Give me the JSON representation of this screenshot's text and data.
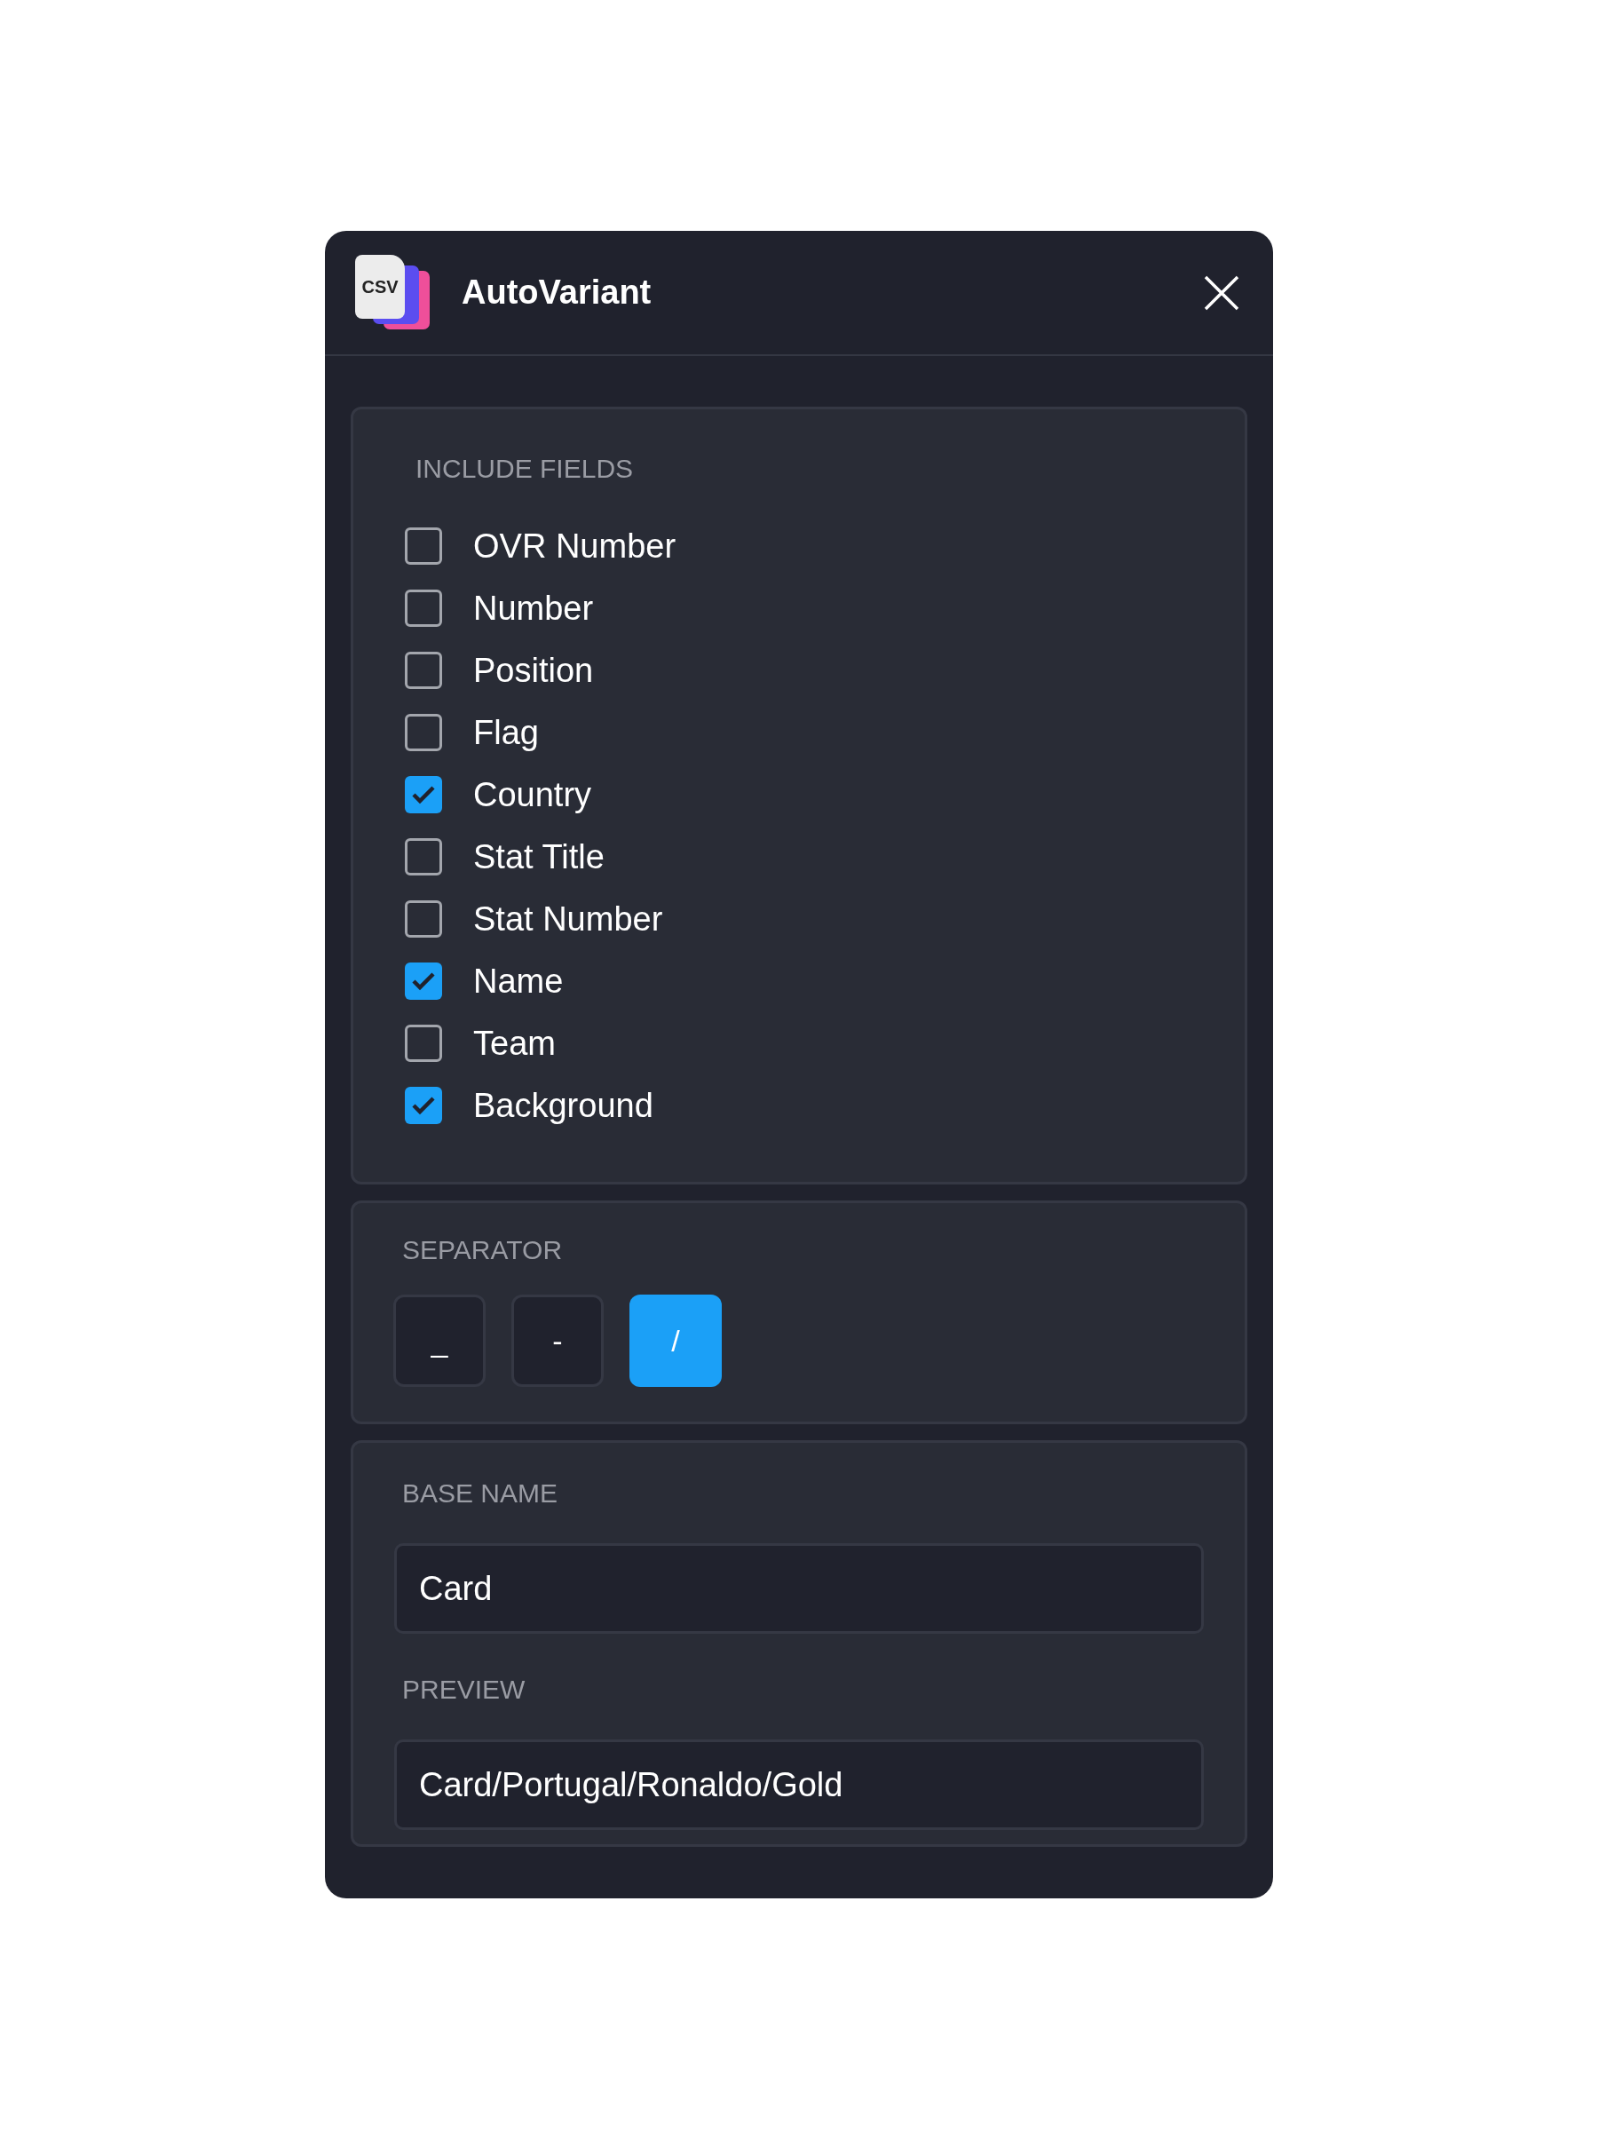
{
  "window": {
    "title": "AutoVariant",
    "logo_text": "CSV"
  },
  "include_fields": {
    "label": "INCLUDE FIELDS",
    "items": [
      {
        "label": "OVR Number",
        "checked": false
      },
      {
        "label": "Number",
        "checked": false
      },
      {
        "label": "Position",
        "checked": false
      },
      {
        "label": "Flag",
        "checked": false
      },
      {
        "label": "Country",
        "checked": true
      },
      {
        "label": "Stat Title",
        "checked": false
      },
      {
        "label": "Stat Number",
        "checked": false
      },
      {
        "label": "Name",
        "checked": true
      },
      {
        "label": "Team",
        "checked": false
      },
      {
        "label": "Background",
        "checked": true
      }
    ]
  },
  "separator": {
    "label": "SEPARATOR",
    "options": [
      {
        "label": "_",
        "selected": false
      },
      {
        "label": "-",
        "selected": false
      },
      {
        "label": "/",
        "selected": true
      }
    ]
  },
  "base_name": {
    "label": "BASE NAME",
    "value": "Card"
  },
  "preview": {
    "label": "PREVIEW",
    "value": "Card/Portugal/Ronaldo/Gold"
  }
}
